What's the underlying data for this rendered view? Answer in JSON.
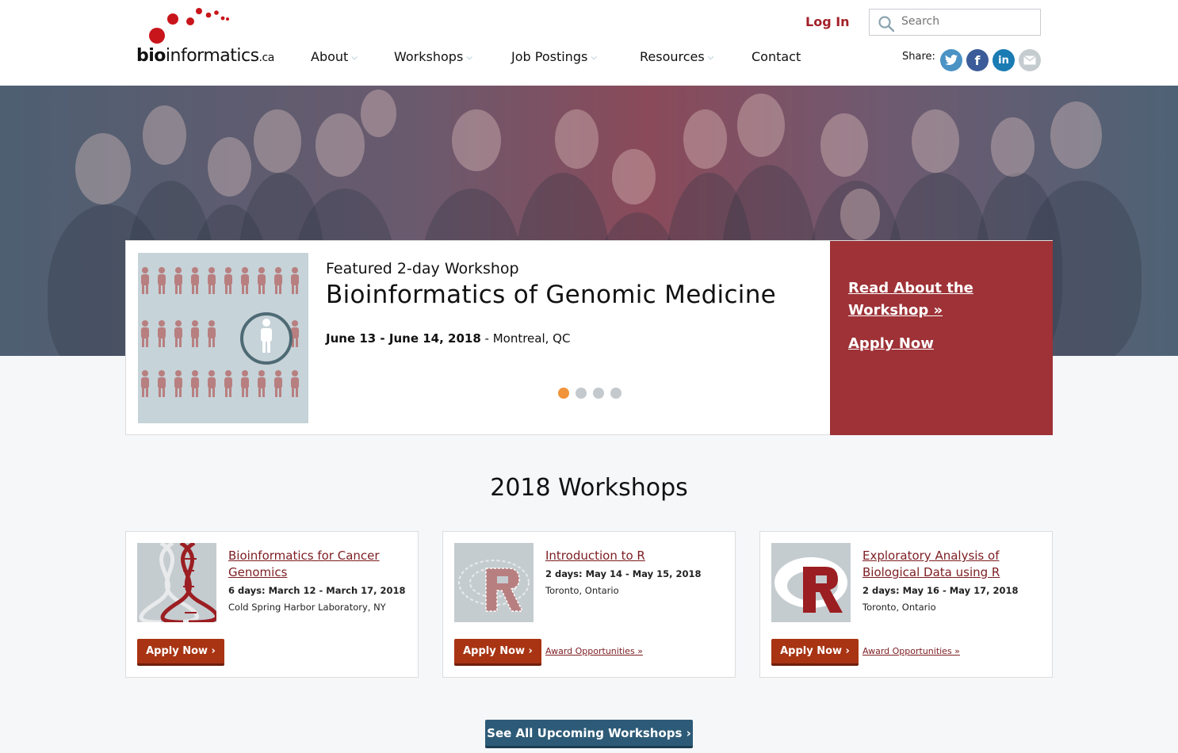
{
  "brand": {
    "prefix": "bio",
    "name": "informatics",
    "suffix": ".ca",
    "accent": "#c8151b"
  },
  "header": {
    "login_label": "Log In",
    "search_placeholder": "Search",
    "share_label": "Share:",
    "share_icons": [
      "twitter-icon",
      "facebook-icon",
      "linkedin-icon",
      "email-icon"
    ]
  },
  "nav": {
    "items": [
      {
        "label": "About",
        "dropdown": true
      },
      {
        "label": "Workshops",
        "dropdown": true
      },
      {
        "label": "Job Postings",
        "dropdown": true
      },
      {
        "label": "Resources",
        "dropdown": true
      },
      {
        "label": "Contact",
        "dropdown": false
      }
    ]
  },
  "featured": {
    "kicker": "Featured 2-day Workshop",
    "title": "Bioinformatics of Genomic Medicine",
    "dates": "June 13 - June 14, 2018",
    "location": " - Montreal, QC",
    "read_link": "Read About the Workshop »",
    "apply_link": "Apply Now",
    "carousel_total": 4,
    "carousel_active": 1,
    "side_color": "#9e3237"
  },
  "workshops": {
    "title": "2018 Workshops",
    "cards": [
      {
        "title": "Bioinformatics for Cancer Genomics",
        "dates": "6 days: March 12 - March 17, 2018",
        "location": "Cold Spring Harbor Laboratory, NY",
        "apply_label": "Apply Now ›",
        "award_label": "",
        "icon": "dna-icon"
      },
      {
        "title": "Introduction to R",
        "dates": "2 days: May 14 - May 15, 2018",
        "location": "Toronto, Ontario",
        "apply_label": "Apply Now ›",
        "award_label": "Award Opportunities »",
        "icon": "r-logo-icon"
      },
      {
        "title": "Exploratory Analysis of Biological Data using R",
        "dates": "2 days: May 16 - May 17, 2018",
        "location": "Toronto, Ontario",
        "apply_label": "Apply Now ›",
        "award_label": "Award Opportunities »",
        "icon": "r-logo-icon"
      }
    ],
    "see_all_label": "See All Upcoming Workshops ›"
  }
}
